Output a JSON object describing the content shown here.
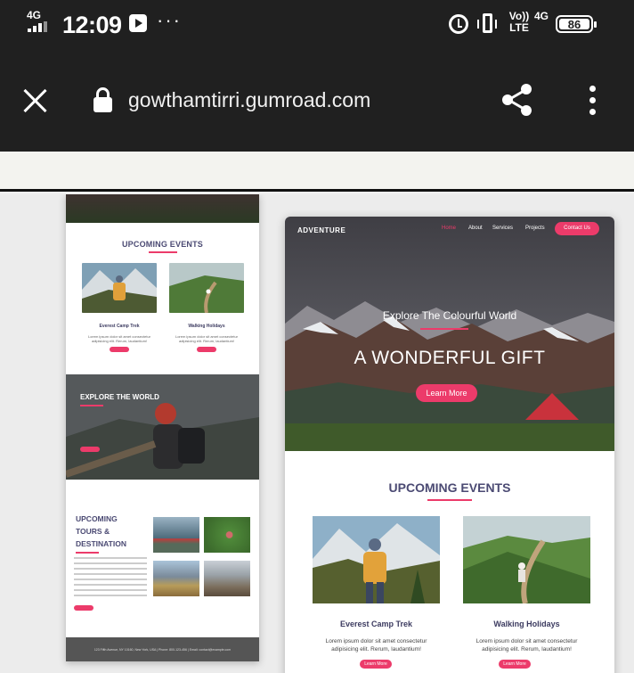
{
  "status_bar": {
    "network": "4G",
    "time": "12:09",
    "more": "···",
    "volte": "Vo)) LTE",
    "data_type": "4G",
    "battery": "86"
  },
  "browser": {
    "url": "gowthamtirri.gumroad.com"
  },
  "mobile_preview": {
    "events_title": "UPCOMING EVENTS",
    "events": [
      {
        "title": "Everest Camp Trek",
        "text": "Lorem ipsum dolor sit amet consectetur adipisicing elit. Rerum, laudantium!"
      },
      {
        "title": "Walking Holidays",
        "text": "Lorem ipsum dolor sit amet consectetur adipisicing elit. Rerum, laudantium!"
      }
    ],
    "explore_title": "EXPLORE THE WORLD",
    "tours_title_1": "UPCOMING",
    "tours_title_2": "TOURS &",
    "tours_title_3": "DESTINATION",
    "footer": "123 Fifth Avenue, NY 10160, New York, USA | Phone: 800-123-456 | Email: contact@example.com"
  },
  "desktop_preview": {
    "brand": "ADVENTURE",
    "nav": [
      "Home",
      "About",
      "Services",
      "Projects"
    ],
    "contact": "Contact Us",
    "tagline": "Explore The Colourful World",
    "headline": "A WONDERFUL GIFT",
    "learn_more": "Learn More",
    "events_title": "UPCOMING EVENTS",
    "events": [
      {
        "title": "Everest Camp Trek",
        "text_1": "Lorem ipsum dolor sit amet consectetur",
        "text_2": "adipisicing elit. Rerum, laudantium!",
        "button": "Learn More"
      },
      {
        "title": "Walking Holidays",
        "text_1": "Lorem ipsum dolor sit amet consectetur",
        "text_2": "adipisicing elit. Rerum, laudantium!",
        "button": "Learn More"
      }
    ]
  },
  "colors": {
    "accent": "#ec3b6a",
    "heading": "#4b4a73",
    "bar": "#202020"
  }
}
